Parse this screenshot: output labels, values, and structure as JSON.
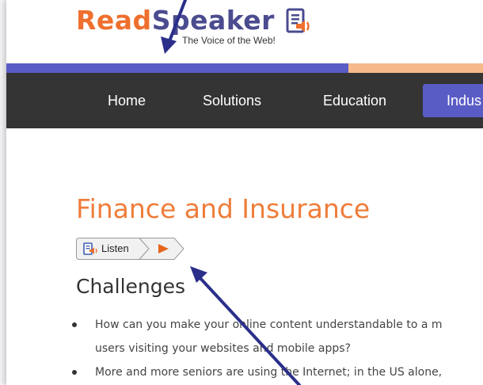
{
  "brand": {
    "read": "Read",
    "speaker": "Speaker",
    "tagline": "The Voice of the Web!"
  },
  "nav": {
    "items": [
      {
        "label": "Home"
      },
      {
        "label": "Solutions"
      },
      {
        "label": "Education"
      },
      {
        "label": "Indus",
        "active": true
      }
    ]
  },
  "page": {
    "title": "Finance and Insurance",
    "subtitle": "Challenges"
  },
  "listen": {
    "label": "Listen",
    "speaker_icon": "speaker-icon",
    "play_icon": "play-icon"
  },
  "bullets": [
    {
      "line1": "How can you make your online content understandable to a m",
      "line2": "users visiting your websites and mobile apps?"
    },
    {
      "line1": "More and more seniors are using the Internet; in the US alone,",
      "line2": ""
    }
  ],
  "colors": {
    "brand_orange": "#ef6f2e",
    "brand_purple": "#4b4b8f",
    "nav_bg": "#343434",
    "nav_active": "#5a5cc6",
    "stripe_blue": "#5a5cc6",
    "stripe_orange": "#f6b98a",
    "title_orange": "#ef7d3a",
    "annotation_arrow": "#2b2f8a"
  }
}
